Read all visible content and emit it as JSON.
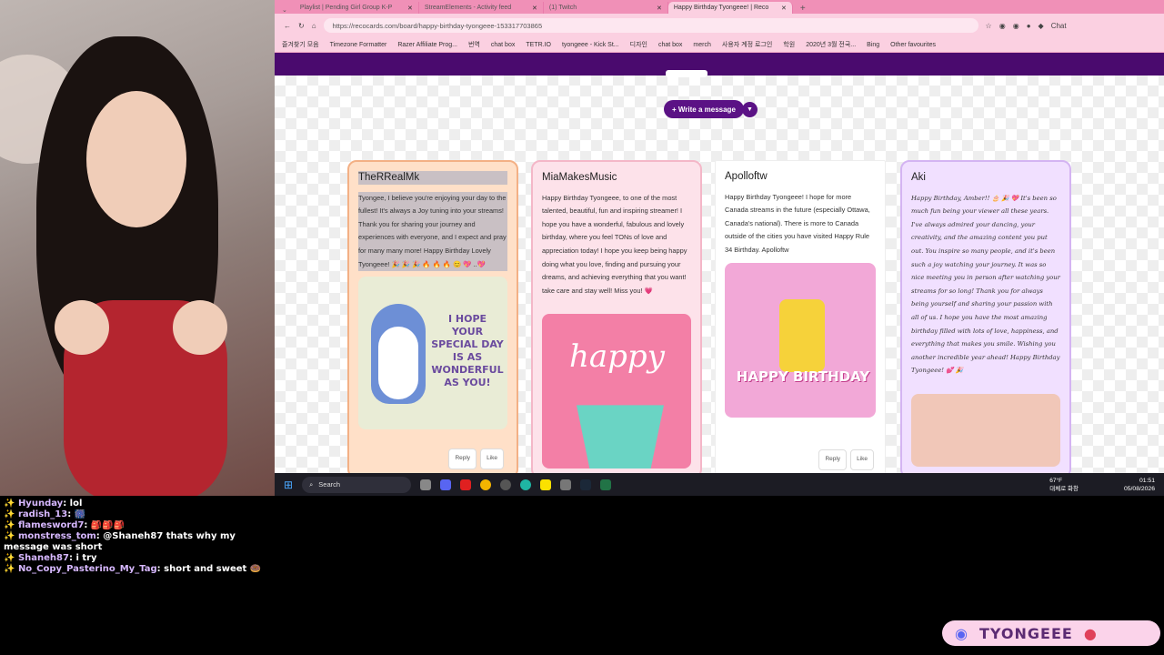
{
  "browser": {
    "tabs": [
      {
        "label": "Playlist | Pending Girl Group K-P"
      },
      {
        "label": "StreamElements - Activity feed"
      },
      {
        "label": "(1) Twitch"
      },
      {
        "label": "Happy Birthday Tyongeee! | Reco"
      }
    ],
    "url": "https://recocards.com/board/happy-birthday-tyongeee-153317703865",
    "bookmarks": [
      "즐겨찾기 모음",
      "Timezone Formatter",
      "Razer Affiliate Prog...",
      "번역",
      "chat box",
      "TETR.IO",
      "tyongeee - Kick St...",
      "디자인",
      "chat box",
      "merch",
      "사용자 계정 로그인",
      "학원",
      "2020년 3월 전국...",
      "Bing",
      "Other favourites"
    ],
    "chat_label": "Chat"
  },
  "board": {
    "write_label": "+ Write a message",
    "cards": [
      {
        "name": "TheRRealMk",
        "message": "Tyongee, I believe you're enjoying your day to the fullest! It's always a Joy tuning into your streams! Thank you for sharing your journey and experiences with everyone, and I expect and pray for many many more! Happy Birthday Lovely Tyongeee! 🎉 🎉 🎉 🔥 🔥 🔥 😊 💖 ..💖",
        "image_text": "I HOPE YOUR SPECIAL DAY IS AS WONDERFUL AS YOU!",
        "reply": "Reply",
        "like": "Like"
      },
      {
        "name": "MiaMakesMusic",
        "message": "Happy Birthday Tyongeee, to one of the most talented, beautiful, fun and inspiring streamer! I hope you have a wonderful, fabulous and lovely birthday, where you feel TONs of love and appreciation today! I hope you keep being happy doing what you love, finding and pursuing your dreams, and achieving everything that you want! take care and stay well! Miss you! 💗",
        "image_text": "happy"
      },
      {
        "name": "Apolloftw",
        "message": "Happy Birthday Tyongeee! I hope for more Canada streams in the future (especially Ottawa, Canada's national). There is more to Canada outside of the cities you have visited Happy Rule 34 Birthday. Apolloftw",
        "image_text": "HAPPY BIRTHDAY",
        "reply": "Reply",
        "like": "Like"
      },
      {
        "name": "Aki",
        "message": "Happy Birthday, Amber!! 🎂 🎉 💖 It's been so much fun being your viewer all these years. I've always admired your dancing, your creativity, and the amazing content you put out. You inspire so many people, and it's been such a joy watching your journey. It was so nice meeting you in person after watching your streams for so long! Thank you for always being yourself and sharing your passion with all of us. I hope you have the most amazing birthday filled with lots of love, happiness, and everything that makes you smile. Wishing you another incredible year ahead! Happy Birthday Tyongeee! 💕 🎉"
      }
    ]
  },
  "taskbar": {
    "search": "Search",
    "weather_temp": "67°F",
    "weather_desc": "대체로 화창",
    "time": "01:51",
    "date": "05/08/2026"
  },
  "chat": [
    {
      "user": "Hyunday",
      "text": "lol"
    },
    {
      "user": "radish_13",
      "text": "🎆"
    },
    {
      "user": "flamesword7",
      "text": "🎒🎒🎒"
    },
    {
      "user": "monstress_tom",
      "text": "@Shaneh87 thats why my message was short"
    },
    {
      "user": "Shaneh87",
      "text": "i try"
    },
    {
      "user": "No_Copy_Pasterino_My_Tag",
      "text": "short and sweet 🍩"
    }
  ],
  "overlay": {
    "discord_name": "TYONGEEE"
  },
  "colors": {
    "accent": "#5b1285",
    "browser_chrome": "#f090b7",
    "purple_bar": "#4a0a6e"
  }
}
